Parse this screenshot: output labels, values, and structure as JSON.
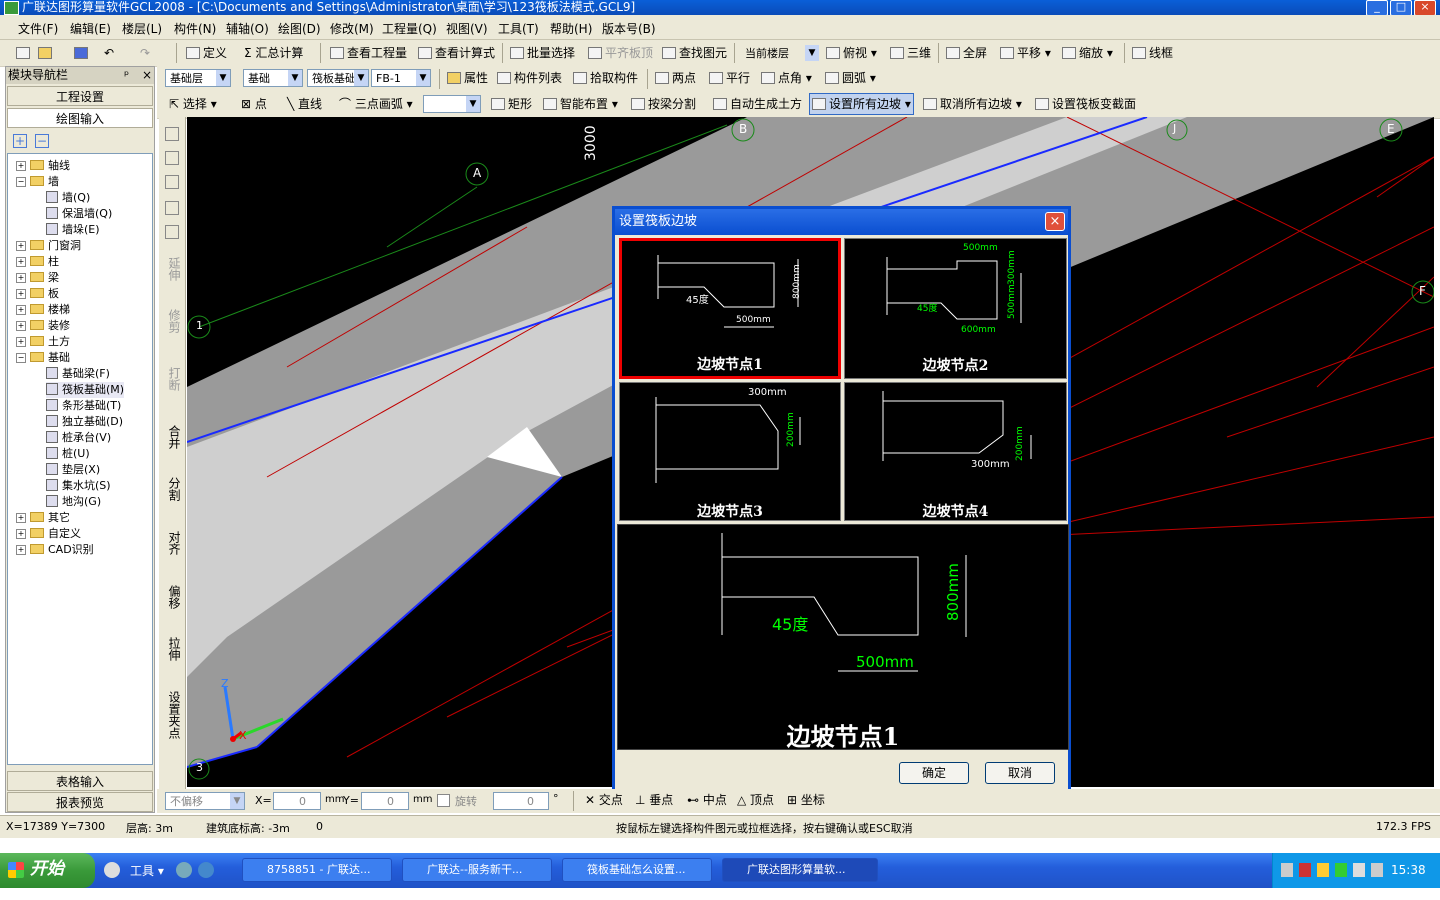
{
  "window": {
    "title": "广联达图形算量软件GCL2008 - [C:\\Documents and Settings\\Administrator\\桌面\\学习\\123筏板法模式.GCL9]"
  },
  "menu": [
    "文件(F)",
    "编辑(E)",
    "楼层(L)",
    "构件(N)",
    "辅轴(O)",
    "绘图(D)",
    "修改(M)",
    "工程量(Q)",
    "视图(V)",
    "工具(T)",
    "帮助(H)",
    "版本号(B)"
  ],
  "toolbar1": {
    "define": "定义",
    "sum": "Σ 汇总计算",
    "view_qty": "查看工程量",
    "view_formula": "查看计算式",
    "batch_select": "批量选择",
    "flat_top": "平齐板顶",
    "find": "查找图元",
    "floor_select": "当前楼层",
    "top_view": "俯视",
    "three_d": "三维",
    "full_screen": "全屏",
    "pan": "平移",
    "zoom": "缩放",
    "wireframe": "线框"
  },
  "toolbar2": {
    "layer": "基础层",
    "category": "基础",
    "component_type": "筏板基础",
    "component": "FB-1",
    "props": "属性",
    "comp_list": "构件列表",
    "pick": "拾取构件",
    "two_point": "两点",
    "parallel": "平行",
    "angle": "点角",
    "arc": "圆弧"
  },
  "toolbar3": {
    "select": "选择",
    "point": "点",
    "line": "直线",
    "three_arc": "三点画弧",
    "rect": "矩形",
    "smart": "智能布置",
    "split_beam": "按梁分割",
    "auto_earth": "自动生成土方",
    "set_all_slope": "设置所有边坡",
    "cancel_all_slope": "取消所有边坡",
    "set_section": "设置筏板变截面"
  },
  "leftpanel": {
    "title": "模块导航栏",
    "pin": "ᵖ",
    "close": "×",
    "project_setup": "工程设置",
    "drawing_input": "绘图输入",
    "table_input": "表格输入",
    "report_preview": "报表预览",
    "tree": [
      {
        "label": "轴线",
        "indent": 0,
        "exp": "+",
        "kind": "folder"
      },
      {
        "label": "墙",
        "indent": 0,
        "exp": "−",
        "kind": "folder"
      },
      {
        "label": "墙(Q)",
        "indent": 1,
        "kind": "leaf"
      },
      {
        "label": "保温墙(Q)",
        "indent": 1,
        "kind": "leaf"
      },
      {
        "label": "墙垛(E)",
        "indent": 1,
        "kind": "leaf"
      },
      {
        "label": "门窗洞",
        "indent": 0,
        "exp": "+",
        "kind": "folder"
      },
      {
        "label": "柱",
        "indent": 0,
        "exp": "+",
        "kind": "folder"
      },
      {
        "label": "梁",
        "indent": 0,
        "exp": "+",
        "kind": "folder"
      },
      {
        "label": "板",
        "indent": 0,
        "exp": "+",
        "kind": "folder"
      },
      {
        "label": "楼梯",
        "indent": 0,
        "exp": "+",
        "kind": "folder"
      },
      {
        "label": "装修",
        "indent": 0,
        "exp": "+",
        "kind": "folder"
      },
      {
        "label": "土方",
        "indent": 0,
        "exp": "+",
        "kind": "folder"
      },
      {
        "label": "基础",
        "indent": 0,
        "exp": "−",
        "kind": "folder"
      },
      {
        "label": "基础梁(F)",
        "indent": 1,
        "kind": "leaf"
      },
      {
        "label": "筏板基础(M)",
        "indent": 1,
        "kind": "leaf"
      },
      {
        "label": "条形基础(T)",
        "indent": 1,
        "kind": "leaf"
      },
      {
        "label": "独立基础(D)",
        "indent": 1,
        "kind": "leaf"
      },
      {
        "label": "桩承台(V)",
        "indent": 1,
        "kind": "leaf"
      },
      {
        "label": "桩(U)",
        "indent": 1,
        "kind": "leaf"
      },
      {
        "label": "垫层(X)",
        "indent": 1,
        "kind": "leaf"
      },
      {
        "label": "集水坑(S)",
        "indent": 1,
        "kind": "leaf"
      },
      {
        "label": "地沟(G)",
        "indent": 1,
        "kind": "leaf"
      },
      {
        "label": "其它",
        "indent": 0,
        "exp": "+",
        "kind": "folder"
      },
      {
        "label": "自定义",
        "indent": 0,
        "exp": "+",
        "kind": "folder"
      },
      {
        "label": "CAD识别",
        "indent": 0,
        "exp": "+",
        "kind": "folder"
      }
    ]
  },
  "vtoolbar": [
    {
      "label": "延伸"
    },
    {
      "label": "修剪"
    },
    {
      "label": "打断"
    },
    {
      "label": "合并"
    },
    {
      "label": "分割"
    },
    {
      "label": "对齐"
    },
    {
      "label": "偏移"
    },
    {
      "label": "拉伸"
    },
    {
      "label": "设置夹点"
    }
  ],
  "canvas": {
    "axis_labels": [
      "A",
      "B",
      "E",
      "F",
      "J",
      "1",
      "3"
    ],
    "dim_text": "3000",
    "ucs": [
      "Z",
      "X"
    ]
  },
  "dialog": {
    "title": "设置筏板边坡",
    "close": "×",
    "nodes": [
      {
        "label": "边坡节点1",
        "t1": "45度",
        "t2": "500mm",
        "t3": "800mm"
      },
      {
        "label": "边坡节点2",
        "t1": "500mm",
        "t2": "45度",
        "t3": "600mm",
        "t4": "300mm",
        "t5": "500mm"
      },
      {
        "label": "边坡节点3",
        "t1": "300mm",
        "t2": "200mm"
      },
      {
        "label": "边坡节点4",
        "t1": "300mm",
        "t2": "200mm"
      }
    ],
    "preview": {
      "label": "边坡节点1",
      "deg": "45度",
      "w": "500mm",
      "h": "800mm"
    },
    "ok": "确定",
    "cancel": "取消"
  },
  "inputbar": {
    "mode": "不偏移",
    "x_label": "X=",
    "x_val": "0",
    "unit": "mm",
    "y_label": "Y=",
    "y_val": "0",
    "rotate": "旋转",
    "rot_val": "0",
    "deg_sign": "°",
    "snaps": [
      "交点",
      "垂点",
      "中点",
      "顶点",
      "坐标"
    ]
  },
  "statusbar": {
    "coords": "X=17389 Y=7300",
    "floor_h": "层高: 3m",
    "base_elev": "建筑底标高: -3m",
    "zero": "0",
    "hint": "按鼠标左键选择构件图元或拉框选择，按右键确认或ESC取消",
    "fps": "172.3 FPS"
  },
  "taskbar": {
    "start": "开始",
    "tools": "工具",
    "tasks": [
      "8758851 - 广联达...",
      "广联达--服务新干...",
      "筏板基础怎么设置...",
      "广联达图形算量软..."
    ],
    "clock": "15:38"
  },
  "colors": {
    "selected_border": "#e00000",
    "dialog_green": "#00e000",
    "axis_green": "#1a8a1a",
    "red_lines": "#c00000",
    "blue_line": "#1a2aff"
  }
}
